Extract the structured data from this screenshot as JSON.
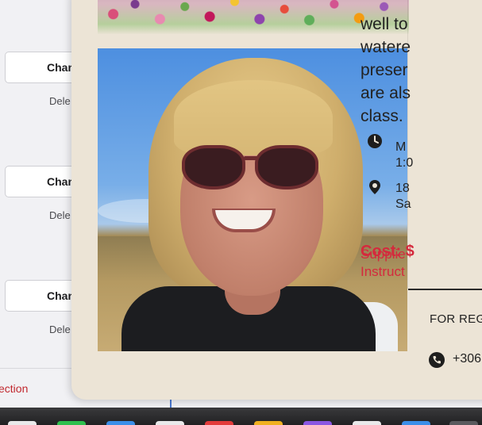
{
  "background_panel": {
    "rows": [
      {
        "button_label": "Chan",
        "delete_label": "Dele"
      },
      {
        "button_label": "Chan",
        "delete_label": "Dele"
      },
      {
        "button_label": "Chan",
        "delete_label": "Dele"
      }
    ],
    "section_link": "ection"
  },
  "modal": {
    "description_lines": [
      "well to",
      "watere",
      "preser",
      "are als",
      "class."
    ],
    "schedule": {
      "icon": "clock-icon",
      "line1": "M",
      "line2": "1:0"
    },
    "location": {
      "icon": "map-pin-icon",
      "line1": "18",
      "line2": "Sa"
    },
    "cost_label": "Cost: $",
    "supplies_line": "Supplie",
    "instructor_line": "Instruct",
    "registration_label": "FOR REGI",
    "phone": {
      "icon": "phone-icon",
      "number": "+306"
    }
  },
  "colors": {
    "modal_bg": "#ece4d6",
    "accent_red": "#d42a3d",
    "section_link_red": "#c1272d"
  }
}
